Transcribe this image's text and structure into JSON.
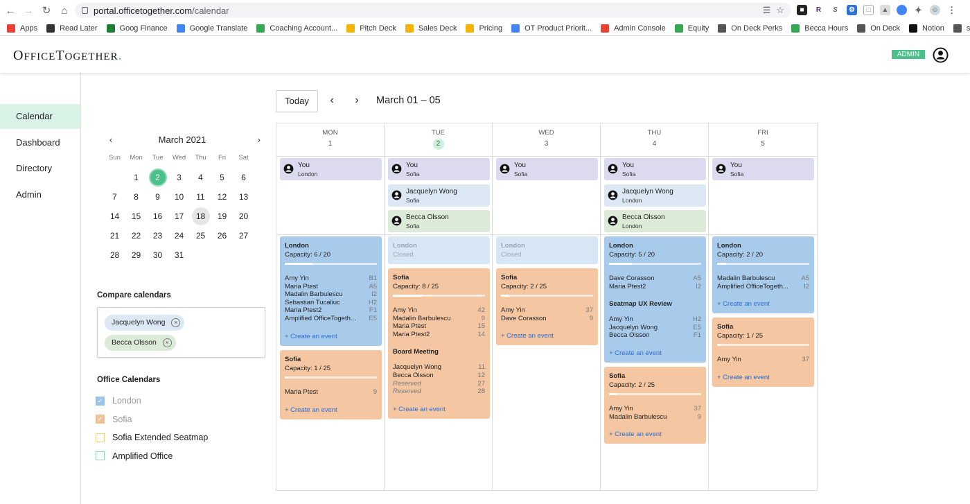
{
  "browser": {
    "url_host": "portal.officetogether.com",
    "url_path": "/calendar",
    "bookmarks": [
      {
        "label": "Apps",
        "color": "#e94235"
      },
      {
        "label": "Read Later",
        "color": "#333333"
      },
      {
        "label": "Goog Finance",
        "color": "#1e7e34"
      },
      {
        "label": "Google Translate",
        "color": "#4285f4"
      },
      {
        "label": "Coaching Account...",
        "color": "#34a853"
      },
      {
        "label": "Pitch Deck",
        "color": "#f4b400"
      },
      {
        "label": "Sales Deck",
        "color": "#f4b400"
      },
      {
        "label": "Pricing",
        "color": "#f4b400"
      },
      {
        "label": "OT Product Priorit...",
        "color": "#4285f4"
      },
      {
        "label": "Admin Console",
        "color": "#ea4335"
      },
      {
        "label": "Equity",
        "color": "#34a853"
      },
      {
        "label": "On Deck Perks",
        "color": "#555555"
      },
      {
        "label": "Becca Hours",
        "color": "#34a853"
      },
      {
        "label": "On Deck",
        "color": "#555555"
      },
      {
        "label": "Notion",
        "color": "#111111"
      },
      {
        "label": "sso",
        "color": "#555555"
      }
    ]
  },
  "header": {
    "logo": "OfficeTogether",
    "logo_dot": ".",
    "admin_badge": "ADMIN",
    "accent": "#4bc08a"
  },
  "sidebar": {
    "items": [
      {
        "label": "Calendar",
        "active": true
      },
      {
        "label": "Dashboard",
        "active": false
      },
      {
        "label": "Directory",
        "active": false
      },
      {
        "label": "Admin",
        "active": false
      }
    ]
  },
  "mini_calendar": {
    "title": "March 2021",
    "prev": "‹",
    "next": "›",
    "weekdays": [
      "Sun",
      "Mon",
      "Tue",
      "Wed",
      "Thu",
      "Fri",
      "Sat"
    ],
    "leading_blanks": 1,
    "days": [
      "1",
      "2",
      "3",
      "4",
      "5",
      "6",
      "7",
      "8",
      "9",
      "10",
      "11",
      "12",
      "13",
      "14",
      "15",
      "16",
      "17",
      "18",
      "19",
      "20",
      "21",
      "22",
      "23",
      "24",
      "25",
      "26",
      "27",
      "28",
      "29",
      "30",
      "31"
    ],
    "today": "2",
    "highlighted": "18"
  },
  "compare": {
    "title": "Compare calendars",
    "chips": [
      {
        "label": "Jacquelyn Wong",
        "color": "#dde8f5"
      },
      {
        "label": "Becca Olsson",
        "color": "#dcebd7"
      }
    ]
  },
  "office_calendars": {
    "title": "Office Calendars",
    "items": [
      {
        "label": "London",
        "checked": true,
        "color": "#9cc3e6",
        "muted": true
      },
      {
        "label": "Sofia",
        "checked": true,
        "color": "#f0c29c",
        "muted": true
      },
      {
        "label": "Sofia Extended Seatmap",
        "checked": false,
        "color": "#f3d27a",
        "muted": false
      },
      {
        "label": "Amplified Office",
        "checked": false,
        "color": "#8fdab4",
        "muted": false
      }
    ]
  },
  "toolbar": {
    "today": "Today",
    "prev": "‹",
    "next": "›",
    "range": "March 01 – 05"
  },
  "colors": {
    "you_card": "#dcdaee",
    "jacquelyn_card": "#dde8f5",
    "becca_card": "#dcebd7",
    "london": "#a9cbeb",
    "london_closed": "#d6e6f5",
    "sofia": "#f4c6a2",
    "link": "#2c6bd1"
  },
  "days": [
    {
      "dow": "MON",
      "num": "1",
      "today": false,
      "people": [
        {
          "name": "You",
          "loc": "London",
          "kind": "you"
        }
      ],
      "offices": [
        {
          "name": "London",
          "cap": "Capacity: 6 / 20",
          "fill": 0.3,
          "kind": "london",
          "people": [
            [
              "Amy Yin",
              "B1"
            ],
            [
              "Maria Ptest",
              "A5"
            ],
            [
              "Madalin Barbulescu",
              "I2"
            ],
            [
              "Sebastian Tucaliuc",
              "H2"
            ],
            [
              "Maria Ptest2",
              "F1"
            ],
            [
              "Amplified OfficeTogeth...",
              "E5"
            ]
          ],
          "events": [],
          "create": "+ Create an event"
        },
        {
          "name": "Sofia",
          "cap": "Capacity: 1 / 25",
          "fill": 0.04,
          "kind": "sofia",
          "people": [
            [
              "Maria Ptest",
              "9"
            ]
          ],
          "events": [],
          "create": "+ Create an event"
        }
      ]
    },
    {
      "dow": "TUE",
      "num": "2",
      "today": true,
      "people": [
        {
          "name": "You",
          "loc": "Sofia",
          "kind": "you"
        },
        {
          "name": "Jacquelyn Wong",
          "loc": "Sofia",
          "kind": "jacquelyn"
        },
        {
          "name": "Becca Olsson",
          "loc": "Sofia",
          "kind": "becca"
        }
      ],
      "offices": [
        {
          "name": "London",
          "cap": "Closed",
          "fill": null,
          "kind": "closed",
          "people": [],
          "events": [],
          "create": ""
        },
        {
          "name": "Sofia",
          "cap": "Capacity: 8 / 25",
          "fill": 0.32,
          "kind": "sofia",
          "people": [
            [
              "Amy Yin",
              "42"
            ],
            [
              "Madalin Barbulescu",
              "9"
            ],
            [
              "Maria Ptest",
              "15"
            ],
            [
              "Maria Ptest2",
              "14"
            ]
          ],
          "events": [
            {
              "title": "Board Meeting",
              "rows": [
                [
                  "Jacquelyn Wong",
                  "11",
                  false
                ],
                [
                  "Becca Olsson",
                  "12",
                  false
                ],
                [
                  "Reserved",
                  "27",
                  true
                ],
                [
                  "Reserved",
                  "28",
                  true
                ]
              ]
            }
          ],
          "create": "+ Create an event"
        }
      ]
    },
    {
      "dow": "WED",
      "num": "3",
      "today": false,
      "people": [
        {
          "name": "You",
          "loc": "Sofia",
          "kind": "you"
        }
      ],
      "offices": [
        {
          "name": "London",
          "cap": "Closed",
          "fill": null,
          "kind": "closed",
          "people": [],
          "events": [],
          "create": ""
        },
        {
          "name": "Sofia",
          "cap": "Capacity: 2 / 25",
          "fill": 0.08,
          "kind": "sofia",
          "people": [
            [
              "Amy Yin",
              "37"
            ],
            [
              "Dave Corasson",
              "9"
            ]
          ],
          "events": [],
          "create": "+ Create an event"
        }
      ]
    },
    {
      "dow": "THU",
      "num": "4",
      "today": false,
      "people": [
        {
          "name": "You",
          "loc": "Sofia",
          "kind": "you"
        },
        {
          "name": "Jacquelyn Wong",
          "loc": "London",
          "kind": "jacquelyn"
        },
        {
          "name": "Becca Olsson",
          "loc": "London",
          "kind": "becca"
        }
      ],
      "offices": [
        {
          "name": "London",
          "cap": "Capacity: 5 / 20",
          "fill": 0.25,
          "kind": "london",
          "people": [
            [
              "Dave Corasson",
              "A5"
            ],
            [
              "Maria Ptest2",
              "I2"
            ]
          ],
          "events": [
            {
              "title": "Seatmap UX Review",
              "rows": [
                [
                  "Amy Yin",
                  "H2",
                  false
                ],
                [
                  "Jacquelyn Wong",
                  "E5",
                  false
                ],
                [
                  "Becca Olsson",
                  "F1",
                  false
                ]
              ]
            }
          ],
          "create": "+ Create an event"
        },
        {
          "name": "Sofia",
          "cap": "Capacity: 2 / 25",
          "fill": 0.08,
          "kind": "sofia",
          "people": [
            [
              "Amy Yin",
              "37"
            ],
            [
              "Madalin Barbulescu",
              "9"
            ]
          ],
          "events": [],
          "create": "+ Create an event"
        }
      ]
    },
    {
      "dow": "FRI",
      "num": "5",
      "today": false,
      "people": [
        {
          "name": "You",
          "loc": "Sofia",
          "kind": "you"
        }
      ],
      "offices": [
        {
          "name": "London",
          "cap": "Capacity: 2 / 20",
          "fill": 0.1,
          "kind": "london",
          "people": [
            [
              "Madalin Barbulescu",
              "A5"
            ],
            [
              "Amplified OfficeTogeth...",
              "I2"
            ]
          ],
          "events": [],
          "create": "+ Create an event"
        },
        {
          "name": "Sofia",
          "cap": "Capacity: 1 / 25",
          "fill": 0.04,
          "kind": "sofia",
          "people": [
            [
              "Amy Yin",
              "37"
            ]
          ],
          "events": [],
          "create": "+ Create an event"
        }
      ]
    }
  ]
}
